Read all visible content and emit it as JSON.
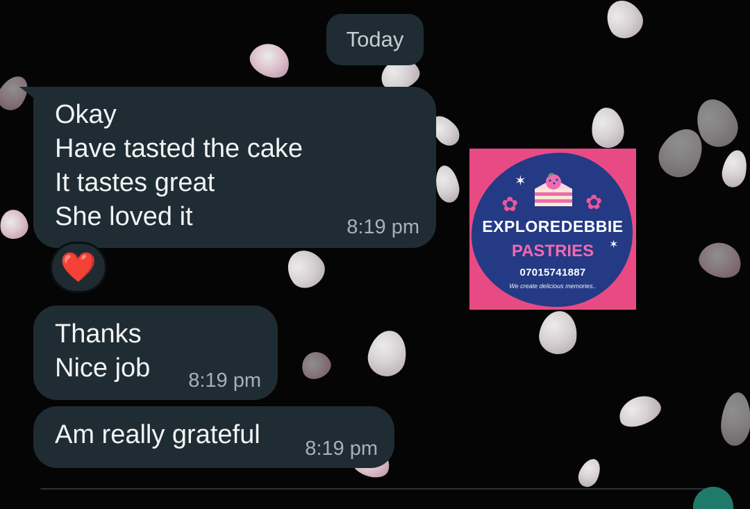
{
  "chat": {
    "date_label": "Today",
    "messages": [
      {
        "lines": [
          "Okay",
          "Have tasted the cake",
          "It tastes great",
          "She loved it"
        ],
        "time": "8:19 pm",
        "reaction": "❤️"
      },
      {
        "lines": [
          "Thanks",
          "Nice job"
        ],
        "time": "8:19 pm"
      },
      {
        "lines": [
          "Am really grateful"
        ],
        "time": "8:19 pm"
      }
    ]
  },
  "profile_badge": {
    "brand_line_1": "EXPLOREDEBBIE",
    "brand_line_2": "PASTRIES",
    "phone": "07015741887",
    "slogan": "We create delicious memories..",
    "colors": {
      "background": "#e84b83",
      "blob": "#243a85",
      "accent": "#ef6bb0"
    }
  },
  "wallpaper": {
    "theme": "blossom-petals"
  }
}
